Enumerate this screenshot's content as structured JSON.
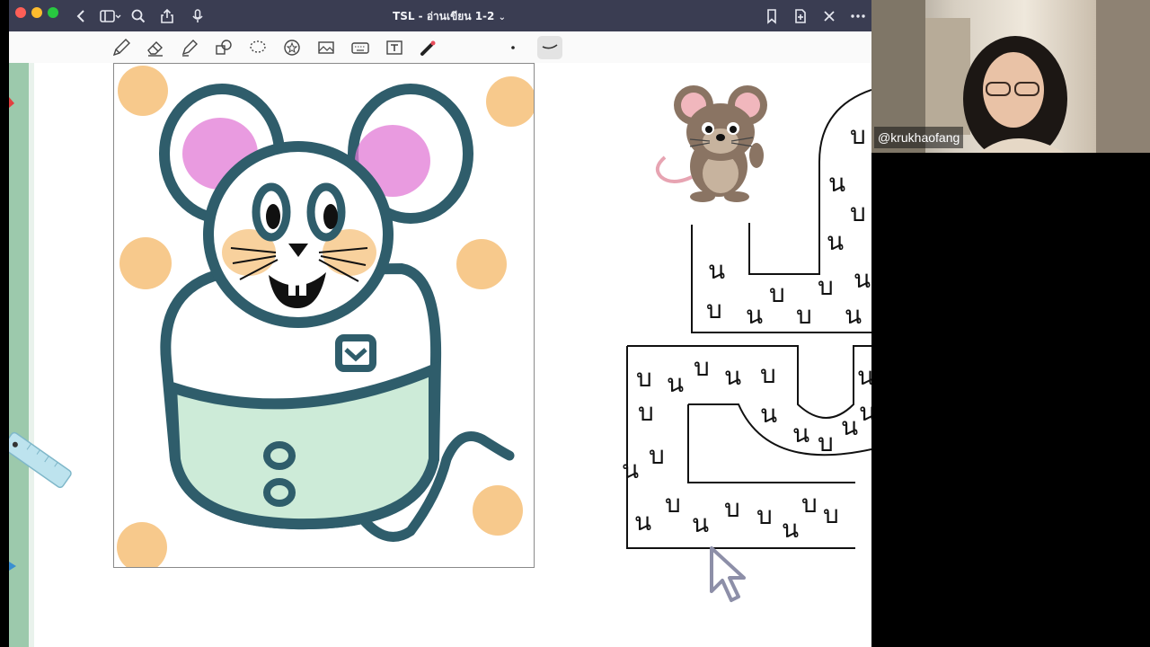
{
  "window": {
    "title": "TSL - อ่านเขียน 1-2",
    "title_chevron": "⌄"
  },
  "titlebar_icons": {
    "left": [
      "back-icon",
      "sidebar-icon",
      "search-icon",
      "share-icon",
      "microphone-icon"
    ],
    "right": [
      "bookmark-icon",
      "add-page-icon",
      "close-icon",
      "more-icon"
    ]
  },
  "toolbar_tools": [
    "pen",
    "eraser",
    "highlighter",
    "shapes",
    "lasso",
    "stickers",
    "image",
    "keyboard",
    "text",
    "laser-pointer",
    "stroke-dot",
    "stroke-curve"
  ],
  "maze": {
    "row1": [
      "น",
      "บ",
      "บ",
      "น",
      "บ",
      "บ",
      "น",
      "น"
    ],
    "top_letters": [
      "บ",
      "น",
      "บ",
      "น",
      "น",
      "บ"
    ],
    "mid_letters": [
      "น",
      "บ",
      "น",
      "บ",
      "บ",
      "น",
      "น",
      "บ",
      "บ",
      "น"
    ],
    "lower_letters": [
      "บ",
      "น",
      "บ",
      "น",
      "บ",
      "บ",
      "น",
      "น",
      "บ",
      "น",
      "น",
      "บ",
      "น",
      "บ"
    ]
  },
  "webcam": {
    "handle": "@krukhaofang"
  },
  "colors": {
    "titlebar": "#3a3d52",
    "mouse_outline": "#2f5d6b",
    "ear_inner": "#e27ad6",
    "pants": "#cdebd8",
    "dots": "#f7c98c",
    "sidebar": "#9cc9ac"
  }
}
